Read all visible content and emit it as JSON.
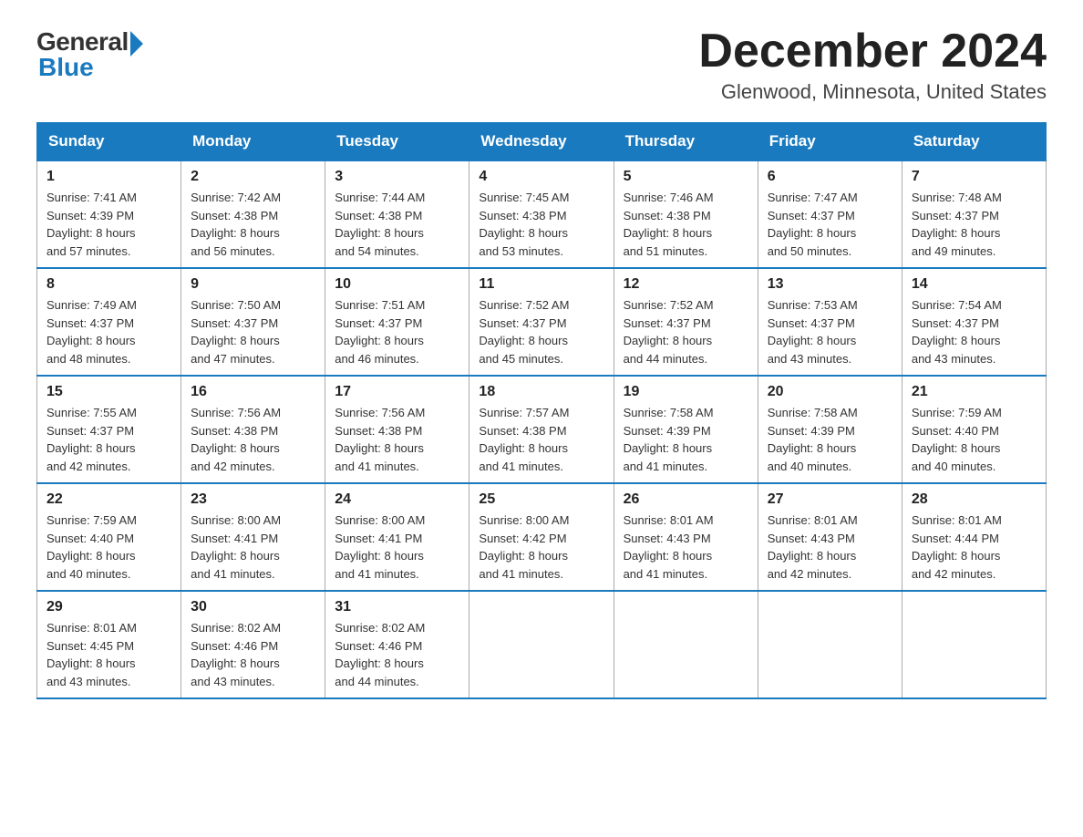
{
  "header": {
    "logo_general": "General",
    "logo_blue": "Blue",
    "month_title": "December 2024",
    "location": "Glenwood, Minnesota, United States"
  },
  "days_of_week": [
    "Sunday",
    "Monday",
    "Tuesday",
    "Wednesday",
    "Thursday",
    "Friday",
    "Saturday"
  ],
  "weeks": [
    [
      {
        "day": "1",
        "sunrise": "7:41 AM",
        "sunset": "4:39 PM",
        "daylight": "8 hours and 57 minutes."
      },
      {
        "day": "2",
        "sunrise": "7:42 AM",
        "sunset": "4:38 PM",
        "daylight": "8 hours and 56 minutes."
      },
      {
        "day": "3",
        "sunrise": "7:44 AM",
        "sunset": "4:38 PM",
        "daylight": "8 hours and 54 minutes."
      },
      {
        "day": "4",
        "sunrise": "7:45 AM",
        "sunset": "4:38 PM",
        "daylight": "8 hours and 53 minutes."
      },
      {
        "day": "5",
        "sunrise": "7:46 AM",
        "sunset": "4:38 PM",
        "daylight": "8 hours and 51 minutes."
      },
      {
        "day": "6",
        "sunrise": "7:47 AM",
        "sunset": "4:37 PM",
        "daylight": "8 hours and 50 minutes."
      },
      {
        "day": "7",
        "sunrise": "7:48 AM",
        "sunset": "4:37 PM",
        "daylight": "8 hours and 49 minutes."
      }
    ],
    [
      {
        "day": "8",
        "sunrise": "7:49 AM",
        "sunset": "4:37 PM",
        "daylight": "8 hours and 48 minutes."
      },
      {
        "day": "9",
        "sunrise": "7:50 AM",
        "sunset": "4:37 PM",
        "daylight": "8 hours and 47 minutes."
      },
      {
        "day": "10",
        "sunrise": "7:51 AM",
        "sunset": "4:37 PM",
        "daylight": "8 hours and 46 minutes."
      },
      {
        "day": "11",
        "sunrise": "7:52 AM",
        "sunset": "4:37 PM",
        "daylight": "8 hours and 45 minutes."
      },
      {
        "day": "12",
        "sunrise": "7:52 AM",
        "sunset": "4:37 PM",
        "daylight": "8 hours and 44 minutes."
      },
      {
        "day": "13",
        "sunrise": "7:53 AM",
        "sunset": "4:37 PM",
        "daylight": "8 hours and 43 minutes."
      },
      {
        "day": "14",
        "sunrise": "7:54 AM",
        "sunset": "4:37 PM",
        "daylight": "8 hours and 43 minutes."
      }
    ],
    [
      {
        "day": "15",
        "sunrise": "7:55 AM",
        "sunset": "4:37 PM",
        "daylight": "8 hours and 42 minutes."
      },
      {
        "day": "16",
        "sunrise": "7:56 AM",
        "sunset": "4:38 PM",
        "daylight": "8 hours and 42 minutes."
      },
      {
        "day": "17",
        "sunrise": "7:56 AM",
        "sunset": "4:38 PM",
        "daylight": "8 hours and 41 minutes."
      },
      {
        "day": "18",
        "sunrise": "7:57 AM",
        "sunset": "4:38 PM",
        "daylight": "8 hours and 41 minutes."
      },
      {
        "day": "19",
        "sunrise": "7:58 AM",
        "sunset": "4:39 PM",
        "daylight": "8 hours and 41 minutes."
      },
      {
        "day": "20",
        "sunrise": "7:58 AM",
        "sunset": "4:39 PM",
        "daylight": "8 hours and 40 minutes."
      },
      {
        "day": "21",
        "sunrise": "7:59 AM",
        "sunset": "4:40 PM",
        "daylight": "8 hours and 40 minutes."
      }
    ],
    [
      {
        "day": "22",
        "sunrise": "7:59 AM",
        "sunset": "4:40 PM",
        "daylight": "8 hours and 40 minutes."
      },
      {
        "day": "23",
        "sunrise": "8:00 AM",
        "sunset": "4:41 PM",
        "daylight": "8 hours and 41 minutes."
      },
      {
        "day": "24",
        "sunrise": "8:00 AM",
        "sunset": "4:41 PM",
        "daylight": "8 hours and 41 minutes."
      },
      {
        "day": "25",
        "sunrise": "8:00 AM",
        "sunset": "4:42 PM",
        "daylight": "8 hours and 41 minutes."
      },
      {
        "day": "26",
        "sunrise": "8:01 AM",
        "sunset": "4:43 PM",
        "daylight": "8 hours and 41 minutes."
      },
      {
        "day": "27",
        "sunrise": "8:01 AM",
        "sunset": "4:43 PM",
        "daylight": "8 hours and 42 minutes."
      },
      {
        "day": "28",
        "sunrise": "8:01 AM",
        "sunset": "4:44 PM",
        "daylight": "8 hours and 42 minutes."
      }
    ],
    [
      {
        "day": "29",
        "sunrise": "8:01 AM",
        "sunset": "4:45 PM",
        "daylight": "8 hours and 43 minutes."
      },
      {
        "day": "30",
        "sunrise": "8:02 AM",
        "sunset": "4:46 PM",
        "daylight": "8 hours and 43 minutes."
      },
      {
        "day": "31",
        "sunrise": "8:02 AM",
        "sunset": "4:46 PM",
        "daylight": "8 hours and 44 minutes."
      },
      null,
      null,
      null,
      null
    ]
  ],
  "labels": {
    "sunrise_prefix": "Sunrise: ",
    "sunset_prefix": "Sunset: ",
    "daylight_prefix": "Daylight: "
  }
}
